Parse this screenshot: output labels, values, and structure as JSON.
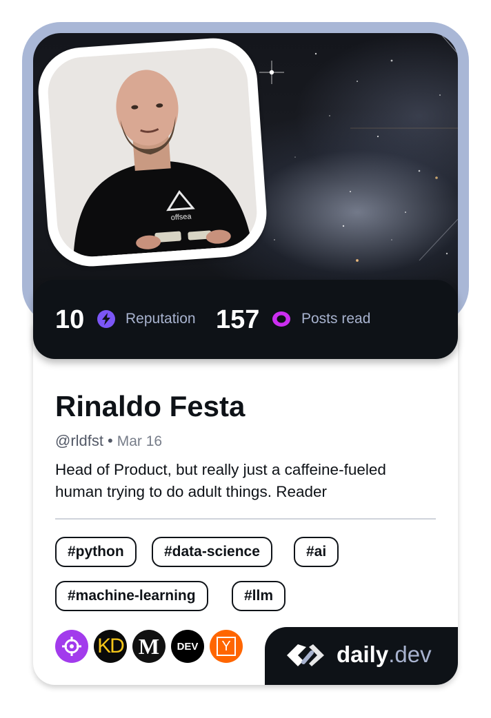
{
  "stats": {
    "reputation_value": "10",
    "reputation_label": "Reputation",
    "posts_value": "157",
    "posts_label": "Posts read",
    "reputation_color": "#7b56f5",
    "posts_color": "#cb2ef0"
  },
  "profile": {
    "name": "Rinaldo Festa",
    "handle": "@rldfst",
    "separator": "•",
    "joined": "Mar 16",
    "bio": "Head of Product, but really just a caffeine-fueled human trying to do adult things. Reader",
    "shirt_logo_text": "offsea"
  },
  "tags": [
    "#python",
    "#data-science",
    "#ai",
    "#machine-learning",
    "#llm"
  ],
  "sources": [
    {
      "icon": "crosshair-icon",
      "color": "#a23bec"
    },
    {
      "icon": "kd-icon",
      "text": "KD",
      "color": "#0a0a0a"
    },
    {
      "icon": "medium-icon",
      "text": "M",
      "color": "#111111"
    },
    {
      "icon": "dev-icon",
      "text": "DEV",
      "color": "#000000"
    },
    {
      "icon": "ycombinator-icon",
      "text": "Y",
      "color": "#ff6600"
    }
  ],
  "brand": {
    "name_main": "daily",
    "name_suffix": ".dev"
  },
  "colors": {
    "frame": "#a9b7d6",
    "dark": "#0e1217"
  }
}
